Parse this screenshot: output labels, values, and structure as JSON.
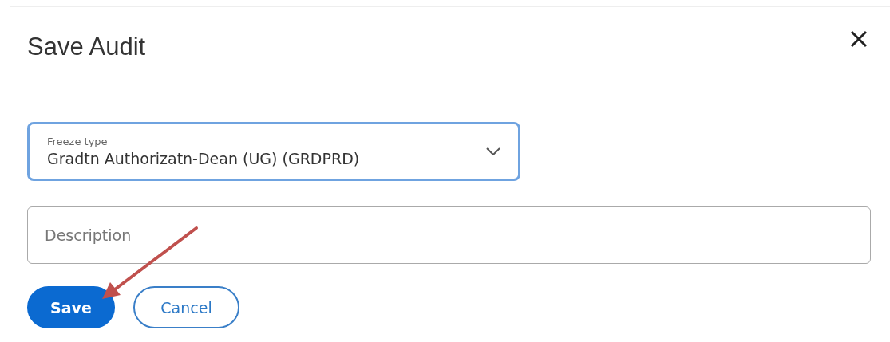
{
  "dialog": {
    "title": "Save Audit",
    "freeze_type": {
      "label": "Freeze type",
      "value": "Gradtn Authorizatn-Dean (UG) (GRDPRD)"
    },
    "description": {
      "placeholder": "Description"
    },
    "buttons": [
      {
        "label": "Save",
        "kind": "primary"
      },
      {
        "label": "Cancel",
        "kind": "secondary"
      }
    ]
  }
}
